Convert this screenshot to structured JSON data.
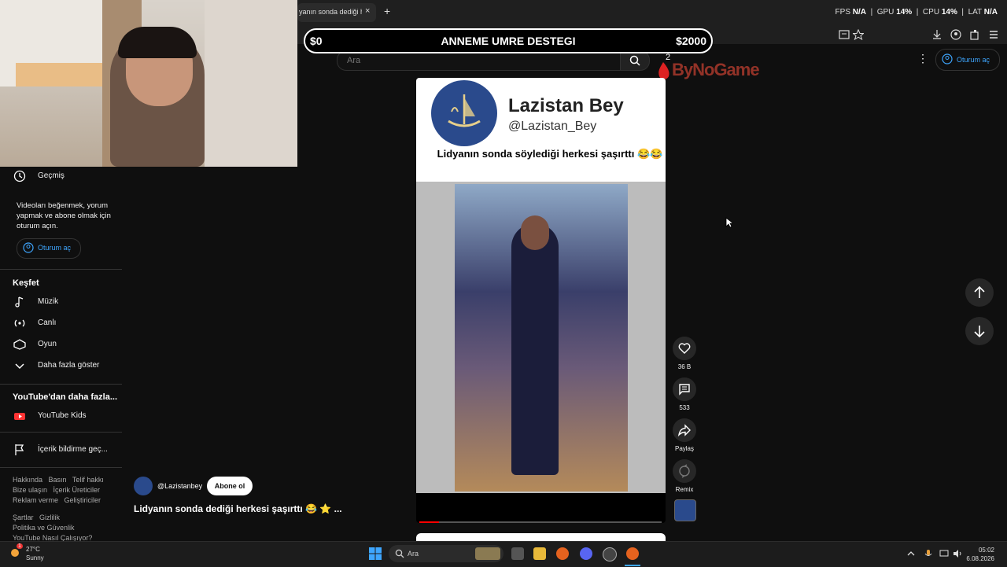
{
  "browser": {
    "tab_title": "yanın sonda dediği herkes şaşırttı",
    "tab_close": "×",
    "new_tab": "+",
    "stats": {
      "fps_label": "FPS",
      "fps_value": "N/A",
      "gpu_label": "GPU",
      "gpu_value": "14%",
      "cpu_label": "CPU",
      "cpu_value": "14%",
      "lat_label": "LAT",
      "lat_value": "N/A"
    }
  },
  "overlay": {
    "donation_left": "$0",
    "donation_title": "ANNEME UMRE DESTEGI",
    "donation_right": "$2000",
    "watermark": "ByNoGame",
    "notification_count": "2"
  },
  "header": {
    "search_placeholder": "Ara",
    "signin_label": "Oturum aç"
  },
  "sidebar": {
    "history_label": "Geçmiş",
    "login_prompt": "Videoları beğenmek, yorum yapmak ve abone olmak için oturum açın.",
    "login_button": "Oturum aç",
    "explore_heading": "Keşfet",
    "explore_items": [
      {
        "label": "Müzik",
        "icon": "music-icon"
      },
      {
        "label": "Canlı",
        "icon": "live-icon"
      },
      {
        "label": "Oyun",
        "icon": "gaming-icon"
      },
      {
        "label": "Daha fazla göster",
        "icon": "chevron-down-icon"
      }
    ],
    "more_heading": "YouTube'dan daha fazla...",
    "youtube_kids": "YouTube Kids",
    "report_label": "İçerik bildirme geç...",
    "footer_row1": [
      "Hakkında",
      "Basın",
      "Telif hakkı"
    ],
    "footer_row2": [
      "Bize ulaşın",
      "İçerik Üreticiler"
    ],
    "footer_row3": [
      "Reklam verme",
      "Geliştiriciler"
    ],
    "footer_row4": [
      "Şartlar",
      "Gizlilik"
    ],
    "footer_row5": "Politika ve Güvenlik",
    "footer_row6": "YouTube Nasıl Çalışıyor?"
  },
  "short": {
    "channel_display_name": "Lazistan Bey",
    "channel_handle_overlay": "@Lazistan_Bey",
    "caption": "Lidyanın sonda söylediği herkesi şaşırttı 😂😂",
    "progress": 0.08
  },
  "actions": {
    "like_count": "36 B",
    "comment_count": "533",
    "share_label": "Paylaş",
    "remix_label": "Remix"
  },
  "channel_bar": {
    "handle": "@Lazistanbey",
    "subscribe_label": "Abone ol",
    "video_title": "Lidyanın sonda dediği herkesi şaşırttı 😂 ⭐ ..."
  },
  "taskbar": {
    "weather_temp": "27°C",
    "weather_desc": "Sunny",
    "weather_badge": "1",
    "search_label": "Ara",
    "time": "05:02",
    "date": "6.08.2026"
  },
  "colors": {
    "background": "#0f0f0f",
    "accent_link": "#3ea6ff",
    "progress_red": "#ff0000"
  }
}
